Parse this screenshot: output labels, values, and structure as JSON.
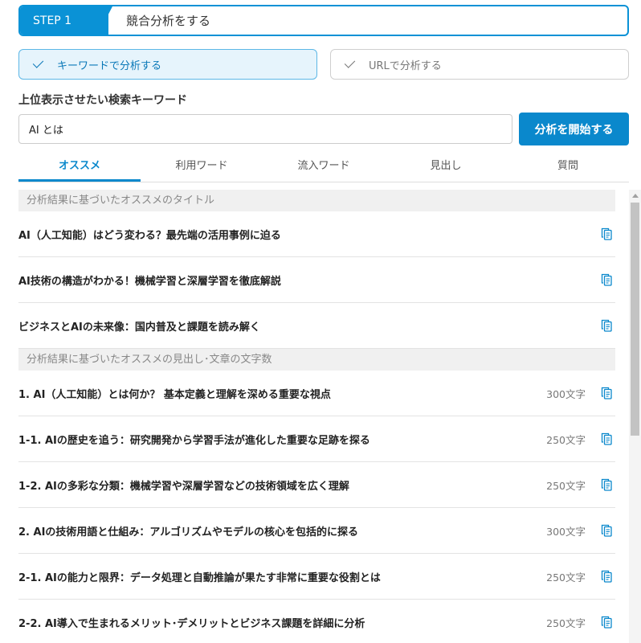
{
  "step": {
    "tag": "STEP 1",
    "title": "競合分析をする"
  },
  "modes": {
    "keyword": "キーワードで分析する",
    "url": "URLで分析する"
  },
  "keyword": {
    "label": "上位表示させたい検索キーワード",
    "value": "AI とは",
    "button": "分析を開始する"
  },
  "tabs": [
    "オススメ",
    "利用ワード",
    "流入ワード",
    "見出し",
    "質問"
  ],
  "sections": {
    "titles": {
      "header": "分析結果に基づいたオススメのタイトル",
      "items": [
        "AI（人工知能）はどう変わる？最先端の活用事例に迫る",
        "AI技術の構造がわかる！機械学習と深層学習を徹底解説",
        "ビジネスとAIの未来像：国内普及と課題を読み解く"
      ]
    },
    "headings": {
      "header": "分析結果に基づいたオススメの見出し･文章の文字数",
      "items": [
        {
          "text": "1. AI（人工知能）とは何か？ 基本定義と理解を深める重要な視点",
          "count": "300文字"
        },
        {
          "text": "1-1. AIの歴史を追う：研究開発から学習手法が進化した重要な足跡を探る",
          "count": "250文字"
        },
        {
          "text": "1-2. AIの多彩な分類：機械学習や深層学習などの技術領域を広く理解",
          "count": "250文字"
        },
        {
          "text": "2. AIの技術用語と仕組み：アルゴリズムやモデルの核心を包括的に探る",
          "count": "300文字"
        },
        {
          "text": "2-1. AIの能力と限界：データ処理と自動推論が果たす非常に重要な役割とは",
          "count": "250文字"
        },
        {
          "text": "2-2. AI導入で生まれるメリット･デメリットとビジネス課題を詳細に分析",
          "count": "250文字"
        }
      ]
    }
  },
  "colors": {
    "accent": "#0a92d6",
    "button": "#0a88cc",
    "section_bg": "#f0f0f0"
  }
}
